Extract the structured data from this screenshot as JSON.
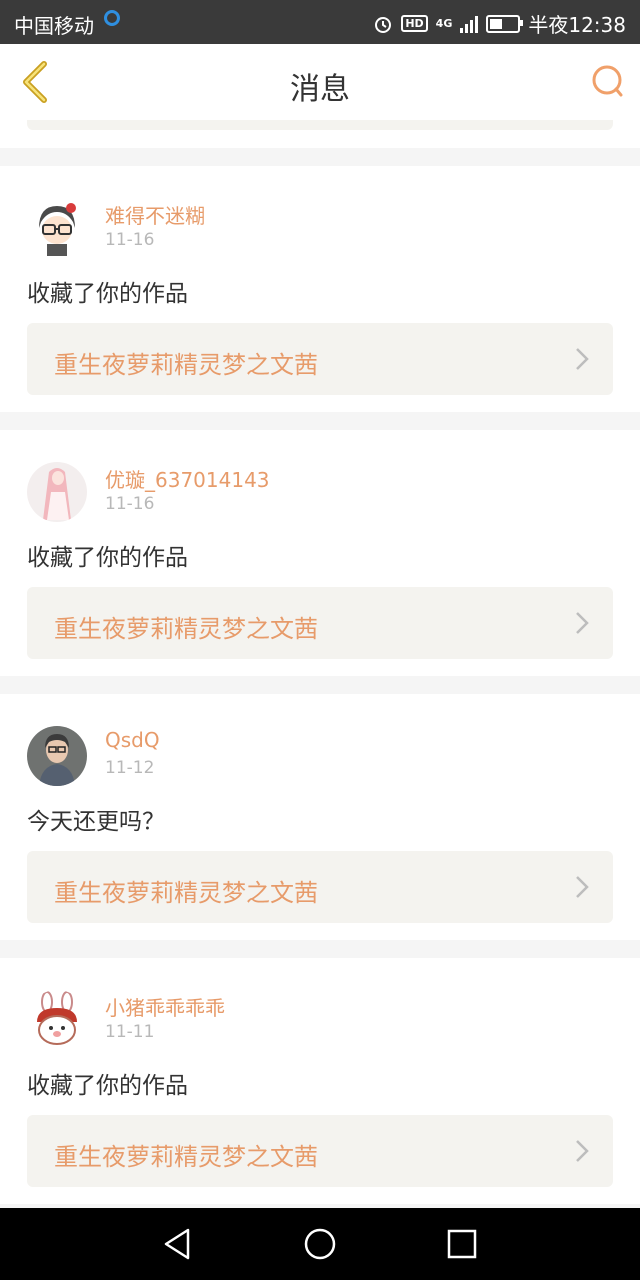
{
  "statusbar": {
    "carrier": "中国移动",
    "hd": "HD",
    "network": "4G",
    "time": "半夜12:38"
  },
  "header": {
    "title": "消息"
  },
  "messages": [
    {
      "name": "难得不迷糊",
      "date": "11-16",
      "text": "收藏了你的作品",
      "work_title": "重生夜萝莉精灵梦之文茜"
    },
    {
      "name": "优璇_637014143",
      "date": "11-16",
      "text": "收藏了你的作品",
      "work_title": "重生夜萝莉精灵梦之文茜"
    },
    {
      "name": "QsdQ",
      "date": "11-12",
      "text": "今天还更吗？",
      "work_title": "重生夜萝莉精灵梦之文茜"
    },
    {
      "name": "小猪乖乖乖乖",
      "date": "11-11",
      "text": "收藏了你的作品",
      "work_title": "重生夜萝莉精灵梦之文茜"
    }
  ],
  "colors": {
    "accent": "#e79b6a",
    "work_bg": "#f4f3ef",
    "back_icon": "#c9a021"
  }
}
